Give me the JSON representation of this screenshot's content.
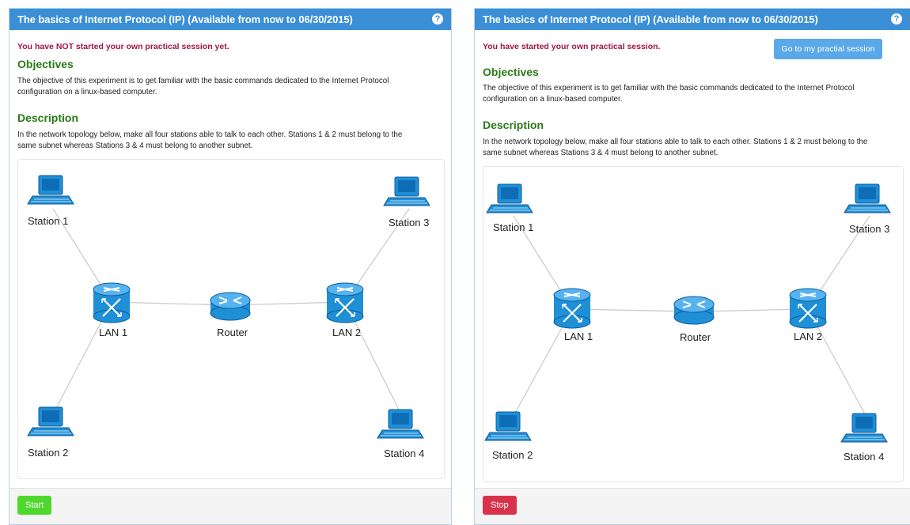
{
  "left": {
    "title": "The basics of Internet Protocol (IP) (Available from now to 06/30/2015)",
    "help_icon": "question-circle-icon",
    "status": "You have NOT started your own practical session yet.",
    "objectives_title": "Objectives",
    "objectives_line1": "The objective of this experiment is to get familiar with the basic commands dedicated to the Internet Protocol",
    "objectives_line2": "configuration on a linux-based computer.",
    "description_title": "Description",
    "description_line1": "In the network topology below, make all four stations able to talk to each other. Stations 1 & 2 must belong to the",
    "description_line2": "same subnet whereas Stations 3 & 4 must belong to another subnet.",
    "button": "Start"
  },
  "right": {
    "title": "The basics of Internet Protocol (IP) (Available from now to 06/30/2015)",
    "help_icon": "question-circle-icon",
    "status": "You have started your own practical session.",
    "session_button": "Go to my practial session",
    "objectives_title": "Objectives",
    "objectives_line1": "The objective of this experiment is to get familiar with the basic commands dedicated to the Internet Protocol",
    "objectives_line2": "configuration on a linux-based computer.",
    "description_title": "Description",
    "description_line1": "In the network topology below, make all four stations able to talk to each other. Stations 1 & 2 must belong to the",
    "description_line2": "same subnet whereas Stations 3 & 4 must belong to another subnet.",
    "button": "Stop"
  },
  "topology": {
    "station1": "Station 1",
    "station2": "Station 2",
    "station3": "Station 3",
    "station4": "Station 4",
    "lan1": "LAN 1",
    "lan2": "LAN 2",
    "router": "Router"
  },
  "colors": {
    "heading": "#3b8fd7",
    "status": "#a3163f",
    "section": "#2a7a16",
    "start": "#4fd82c",
    "stop": "#d9334b",
    "device": "#1f8fd6"
  }
}
